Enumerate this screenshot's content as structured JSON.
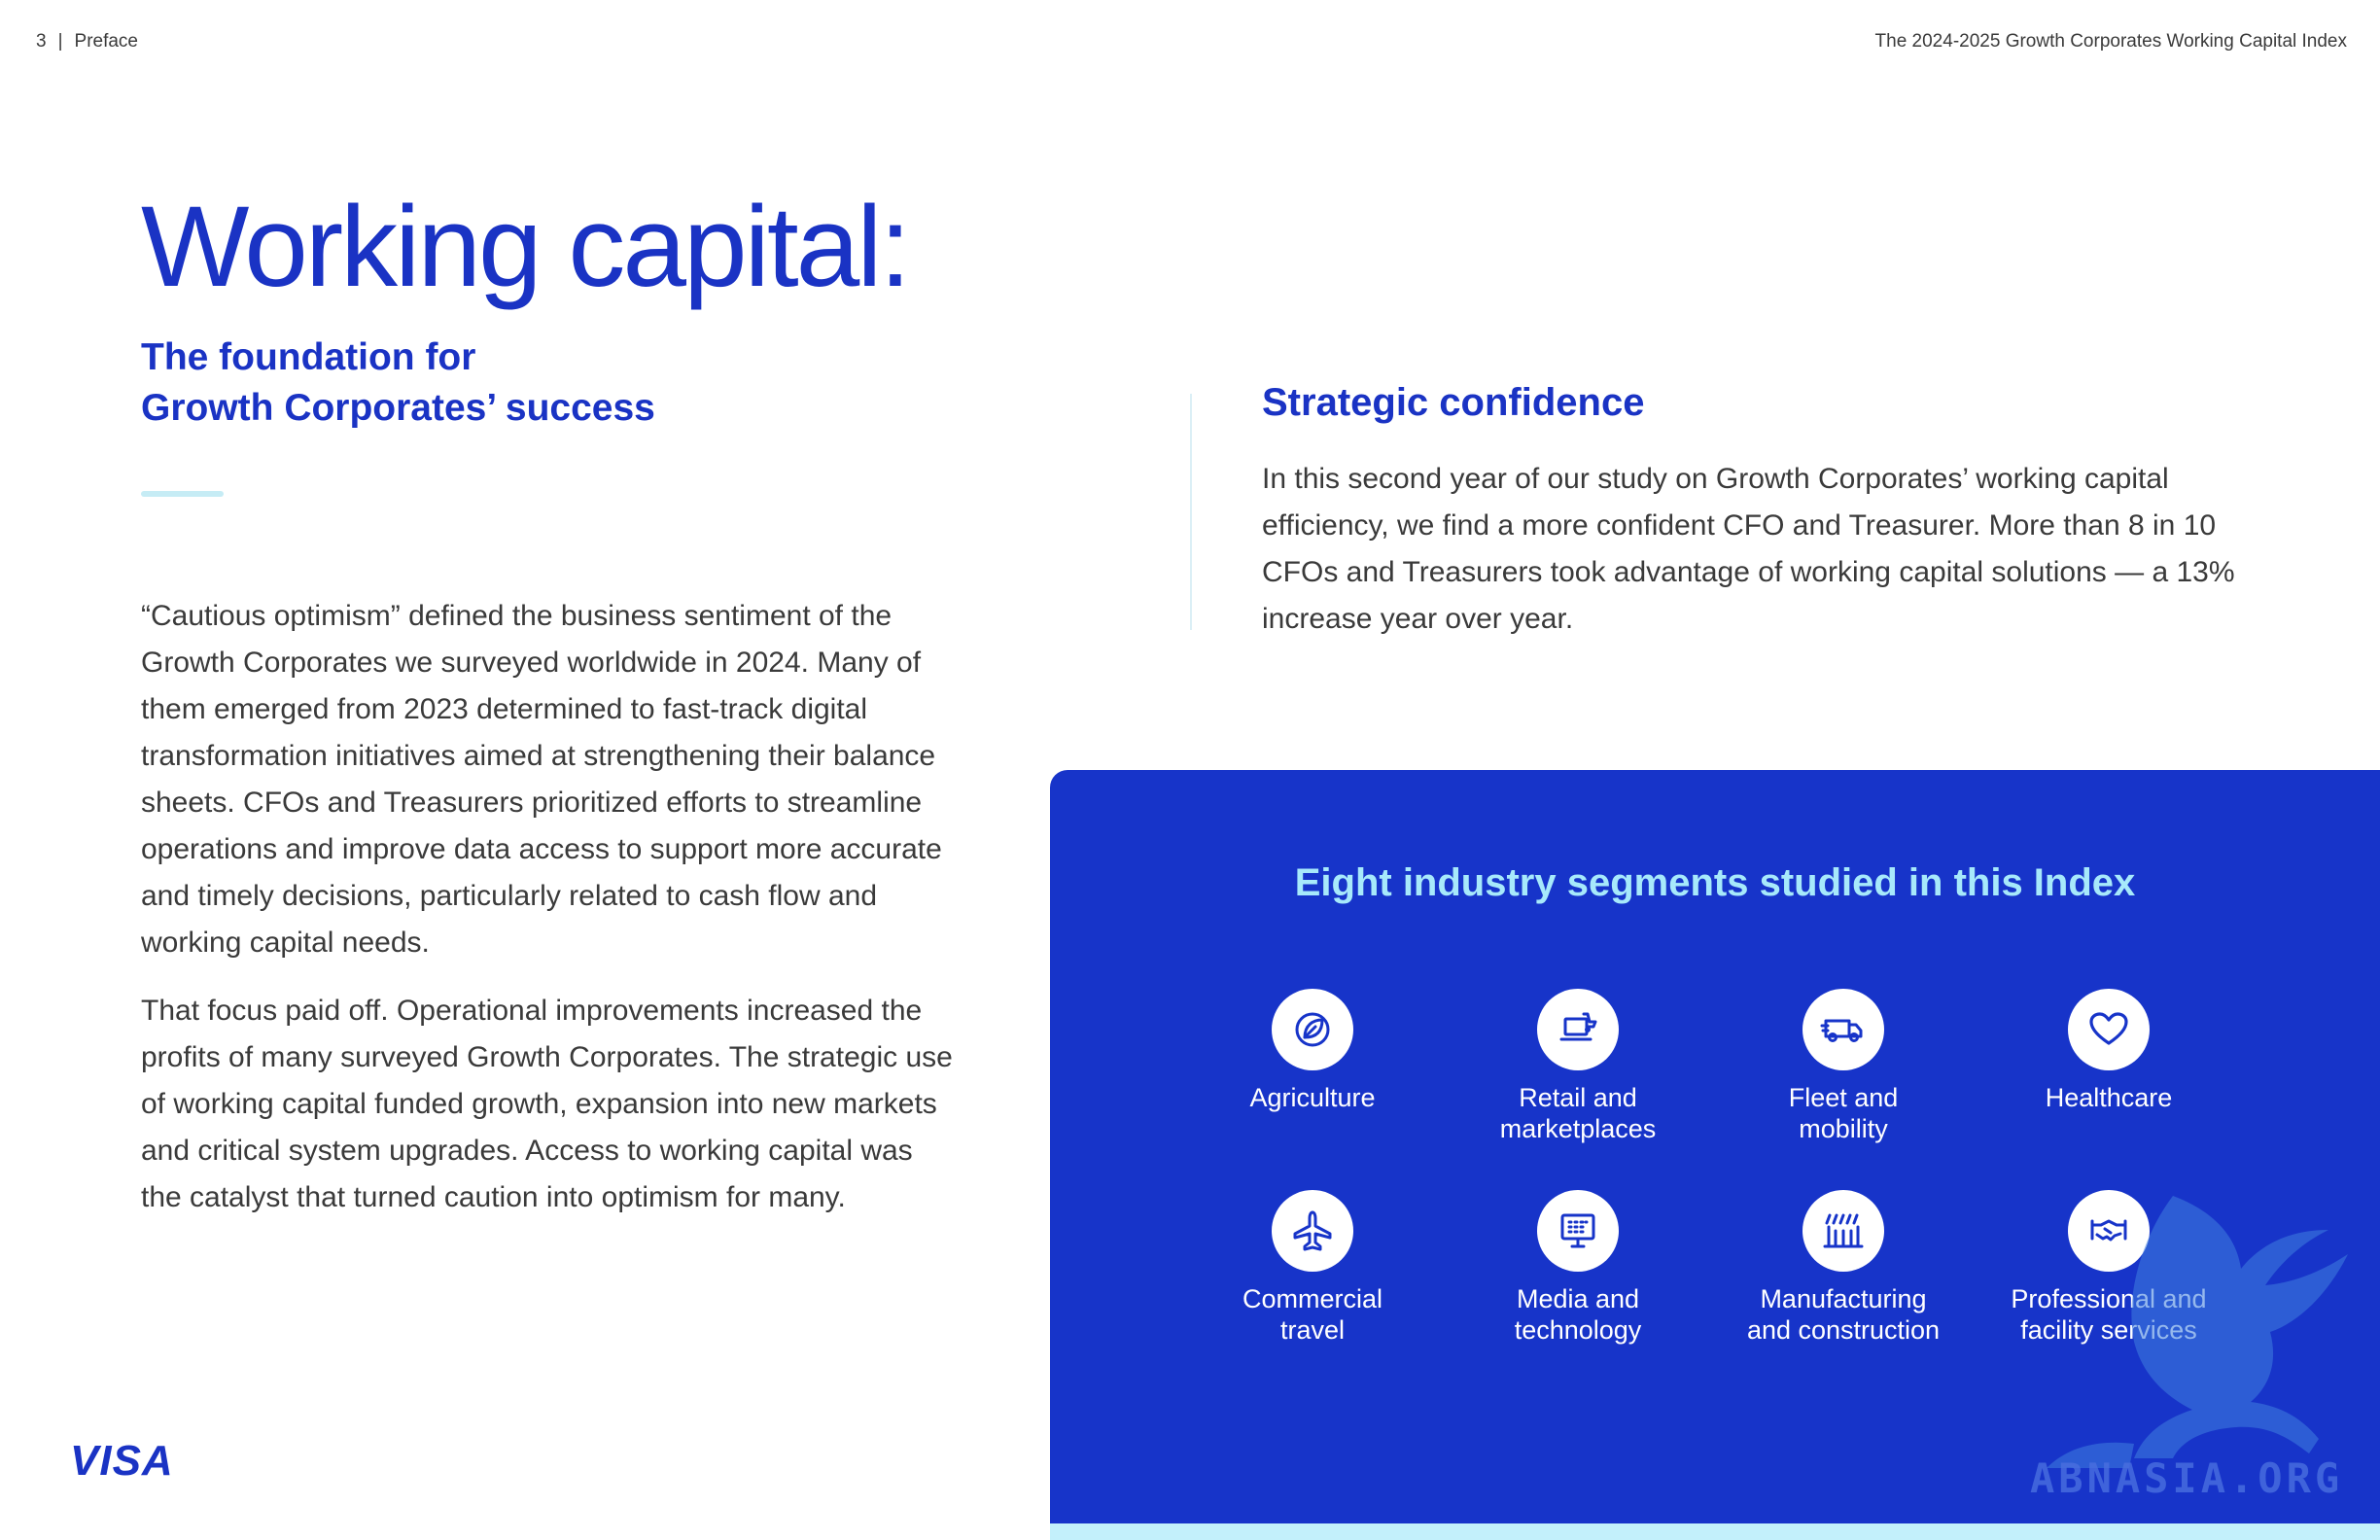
{
  "header": {
    "page_number": "3",
    "separator": "|",
    "section": "Preface",
    "running_title": "The 2024-2025 Growth Corporates Working Capital Index"
  },
  "title": "Working capital:",
  "subtitle": {
    "line1": "The foundation for",
    "line2": "Growth Corporates’ success"
  },
  "body": {
    "para1": "“Cautious optimism” defined the business sentiment of the Growth Corporates we surveyed worldwide in 2024. Many of them emerged from 2023 determined to fast-track digital transformation initiatives aimed at strengthening their balance sheets. CFOs and Treasurers prioritized efforts to streamline operations and improve data access to support more accurate and timely decisions, particularly related to cash flow and working capital needs.",
    "para2": "That focus paid off. Operational improvements increased the profits of many surveyed Growth Corporates. The strategic use of working capital funded growth, expansion into new markets and critical system upgrades. Access to working capital was the catalyst that turned caution into optimism for many."
  },
  "strategic": {
    "title": "Strategic confidence",
    "body": "In this second year of our study on  Growth Corporates’ working capital efficiency, we find a more confident CFO and Treasurer. More than 8 in 10 CFOs and Treasurers took advantage of working capital solutions — a 13% increase year over year."
  },
  "segments": {
    "title": "Eight industry segments studied in this Index",
    "items": [
      {
        "icon": "leaf-icon",
        "line1": "Agriculture",
        "line2": ""
      },
      {
        "icon": "laptop-cart-icon",
        "line1": "Retail and",
        "line2": "marketplaces"
      },
      {
        "icon": "van-icon",
        "line1": "Fleet and",
        "line2": "mobility"
      },
      {
        "icon": "heart-icon",
        "line1": "Healthcare",
        "line2": ""
      },
      {
        "icon": "airplane-icon",
        "line1": "Commercial",
        "line2": "travel"
      },
      {
        "icon": "monitor-icon",
        "line1": "Media and",
        "line2": "technology"
      },
      {
        "icon": "factory-icon",
        "line1": "Manufacturing",
        "line2": "and construction"
      },
      {
        "icon": "handshake-icon",
        "line1": "Professional and",
        "line2": "facility services"
      }
    ]
  },
  "brand": {
    "logo": "VISA",
    "primary_color": "#1a33c4",
    "panel_color": "#1734c9",
    "accent_color": "#a7e9fb"
  },
  "watermark": "ABNASIA.ORG"
}
